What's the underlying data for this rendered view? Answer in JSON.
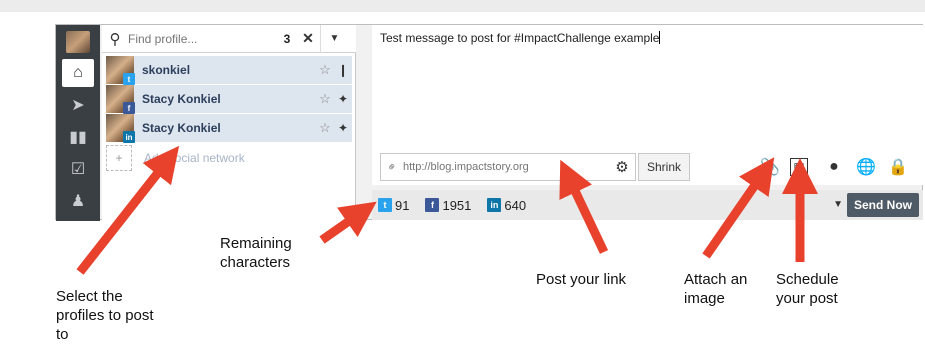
{
  "search": {
    "placeholder": "Find profile...",
    "selected_count": "3",
    "clear_icon": "close-icon",
    "dropdown_icon": "caret-down-icon"
  },
  "profiles": [
    {
      "name": "skonkiel",
      "network": "twitter",
      "badge": "t"
    },
    {
      "name": "Stacy Konkiel",
      "network": "facebook",
      "badge": "f"
    },
    {
      "name": "Stacy Konkiel",
      "network": "linkedin",
      "badge": "in"
    }
  ],
  "add_network": {
    "label": "Add social network"
  },
  "compose": {
    "message": "Test message to post for #ImpactChallenge example",
    "link_placeholder": "http://blog.impactstory.org",
    "shrink_label": "Shrink"
  },
  "remaining": [
    {
      "network": "twitter",
      "badge": "t",
      "count": "91"
    },
    {
      "network": "facebook",
      "badge": "f",
      "count": "1951"
    },
    {
      "network": "linkedin",
      "badge": "in",
      "count": "640"
    }
  ],
  "send": {
    "label": "Send Now"
  },
  "callouts": {
    "select_profiles": "Select the profiles to post to",
    "remaining_chars": "Remaining characters",
    "post_link": "Post your link",
    "attach_image": "Attach an image",
    "schedule_post": "Schedule your post"
  },
  "colors": {
    "nav_bg": "#3a3f44",
    "selected_row": "#dde5ef",
    "twitter": "#2aa3ef",
    "facebook": "#3b5998",
    "linkedin": "#0e76a8",
    "arrow": "#e8412c",
    "send_button": "#4e5a66"
  }
}
